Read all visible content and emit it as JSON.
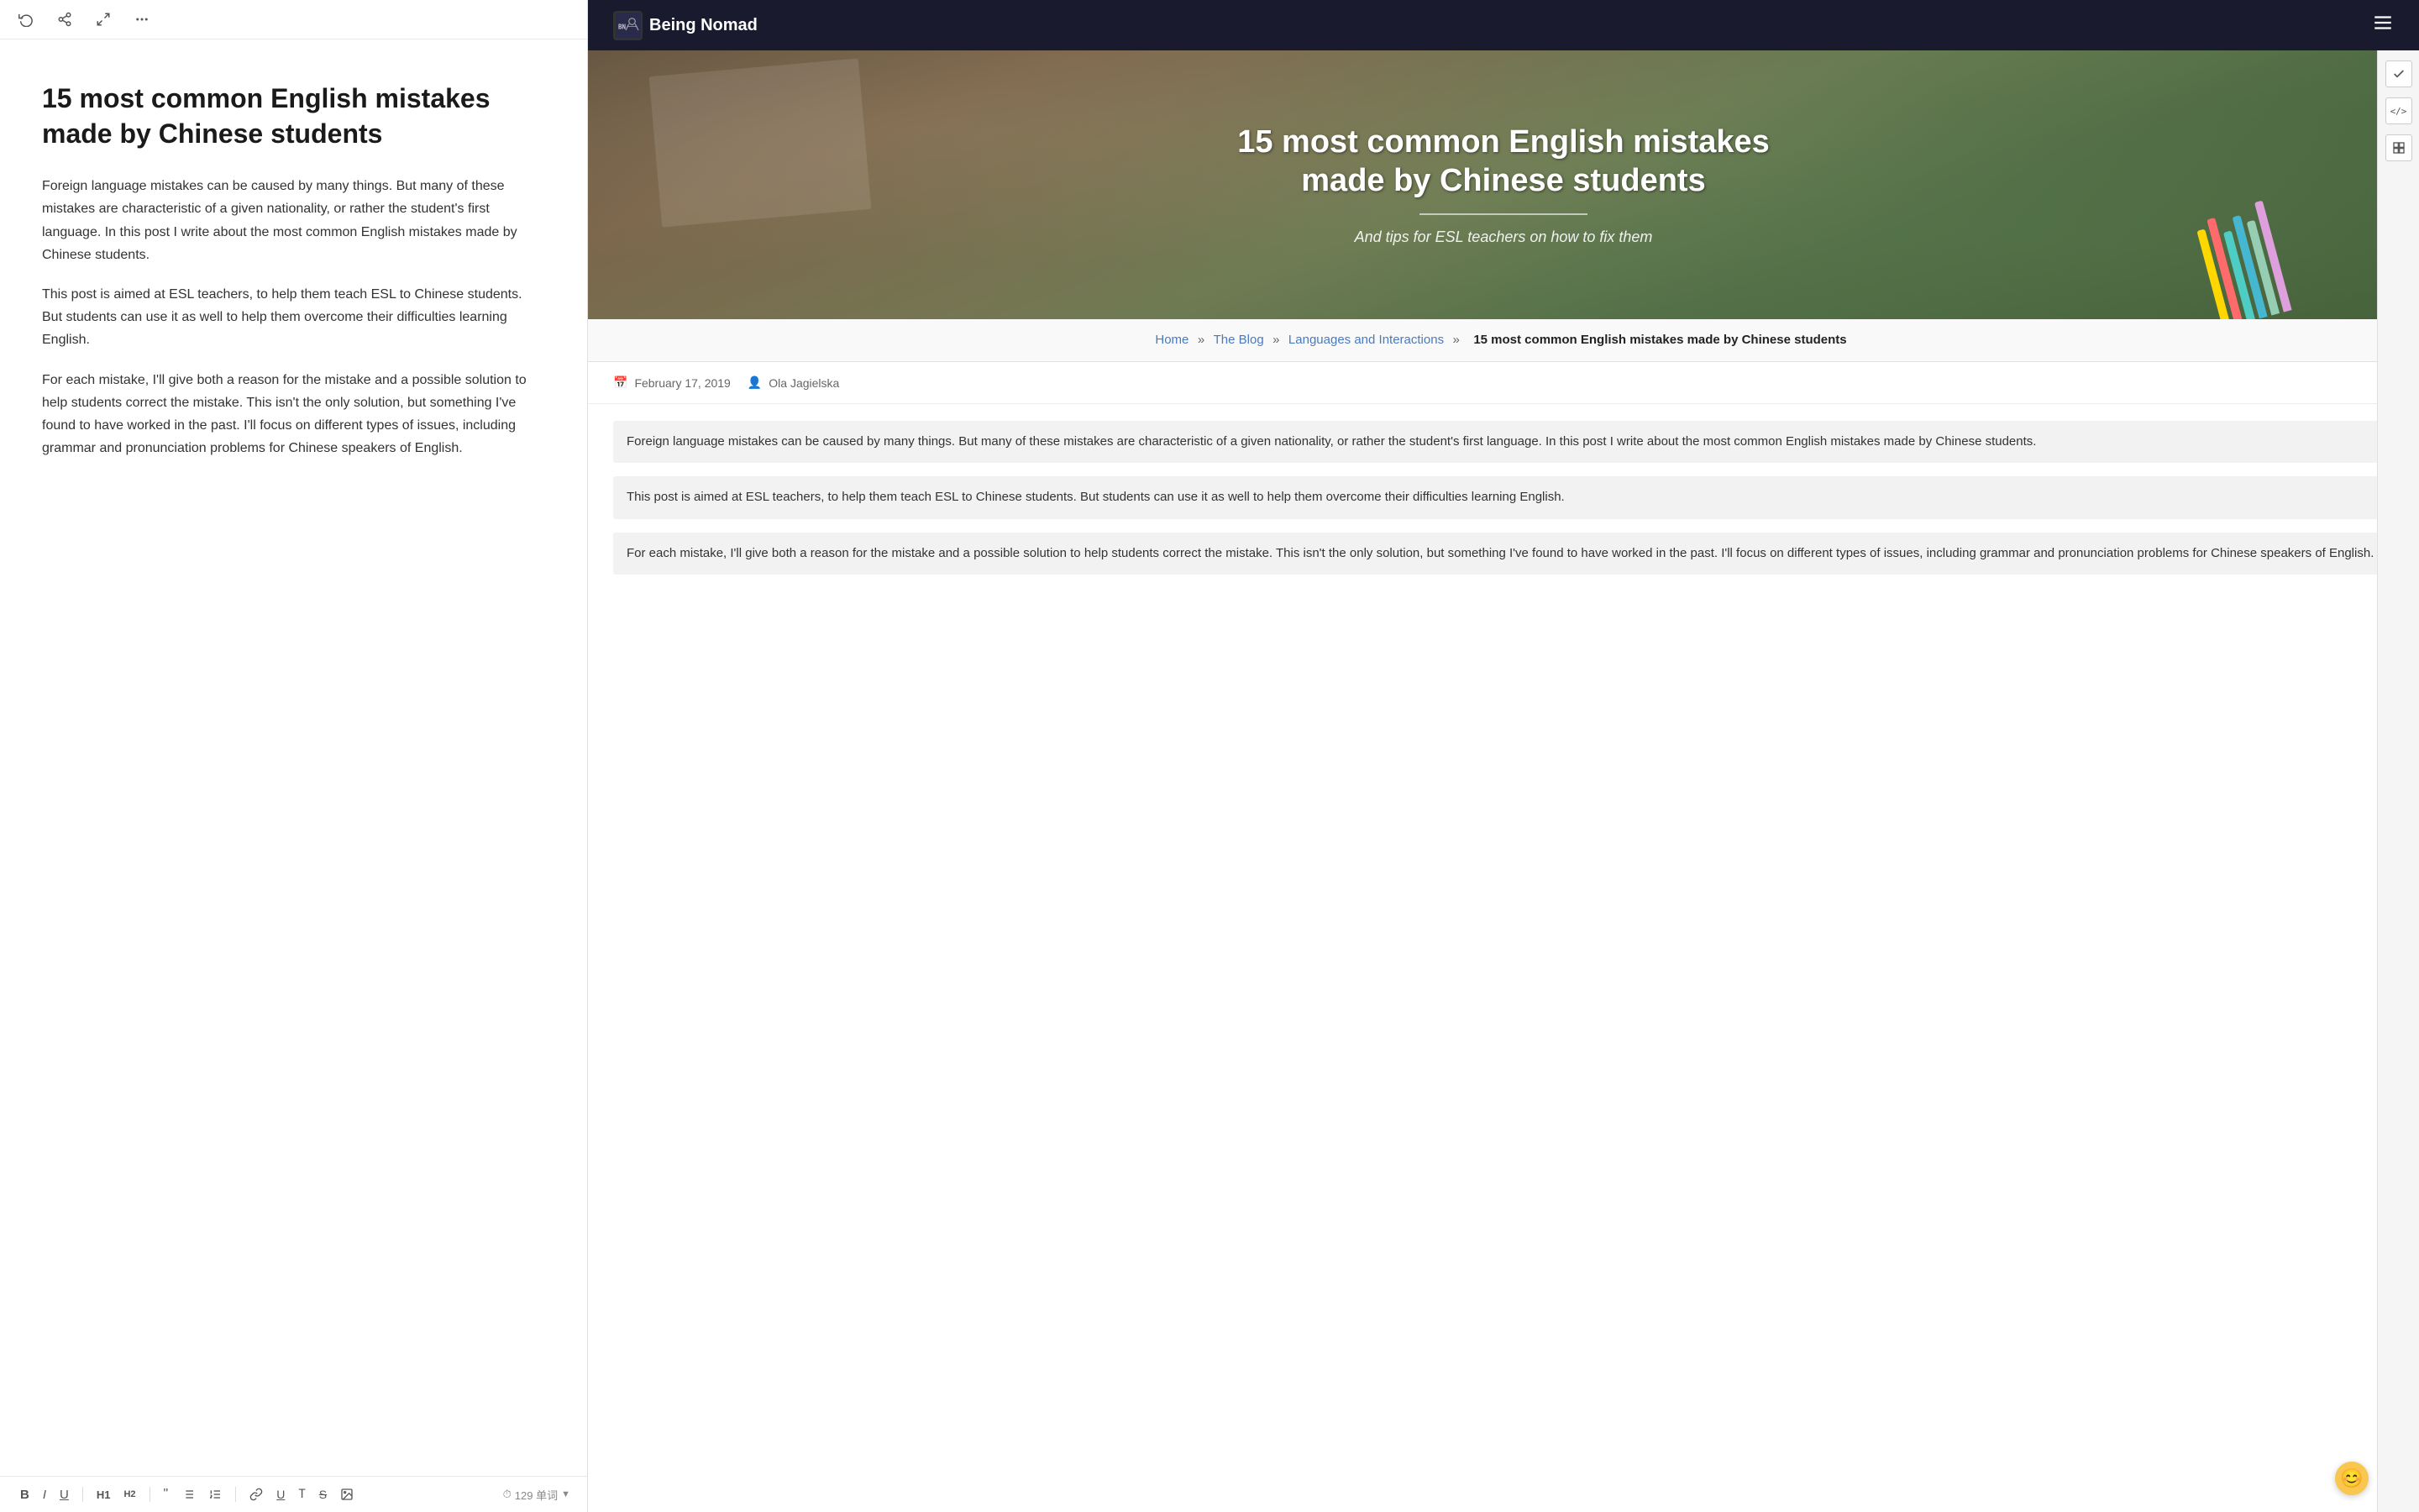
{
  "editor": {
    "toolbar": {
      "refresh_label": "↺",
      "share_label": "⤷",
      "expand_label": "⤢",
      "more_label": "···"
    },
    "title": "15 most common English mistakes made by Chinese students",
    "paragraphs": [
      "Foreign language mistakes can be caused by many things. But many of these mistakes are characteristic of a given nationality, or rather the student's first language. In this post I write about the most common English mistakes made by Chinese students.",
      "This post is aimed at ESL teachers, to help them teach ESL to Chinese students. But students can use it as well to help them overcome their difficulties learning English.",
      "For each mistake, I'll give both a reason for the mistake and a possible solution to help students correct the mistake. This isn't the only solution, but something I've found to have worked in the past. I'll focus on different types of issues, including grammar and pronunciation problems for Chinese speakers of English."
    ],
    "bottom_toolbar": {
      "bold": "B",
      "italic": "I",
      "underline": "U",
      "heading1": "H1",
      "heading2": "H2",
      "quote": "“”",
      "list_unordered": "≡",
      "list_ordered": "≡",
      "link": "🔗",
      "underline2": "U̲",
      "typewriter": "T",
      "strike": "S̶",
      "image": "⊡",
      "word_count": "129 单词",
      "clock_icon": "⏱"
    }
  },
  "website": {
    "nav": {
      "logo_text": "Being Nomad",
      "logo_icon_text": "🏔"
    },
    "hero": {
      "title": "15 most common English mistakes made by Chinese students",
      "subtitle": "And tips for ESL teachers on how to fix them"
    },
    "breadcrumb": {
      "home": "Home",
      "blog": "The Blog",
      "category": "Languages and Interactions",
      "current": "15 most common English mistakes made by Chinese students",
      "separator": "»"
    },
    "post_meta": {
      "date": "February 17, 2019",
      "author": "Ola Jagielska",
      "calendar_icon": "📅",
      "author_icon": "👤"
    },
    "article_paragraphs": [
      "Foreign language mistakes can be caused by many things. But many of these mistakes are characteristic of a given nationality, or rather the student's first language. In this post I write about the most common English mistakes made by Chinese students.",
      "This post is aimed at ESL teachers, to help them teach ESL to Chinese students. But students can use it as well to help them overcome their difficulties learning English.",
      "For each mistake, I'll give both a reason for the mistake and a possible solution to help students correct the mistake. This isn't the only solution, but something I've found to have worked in the past. I'll focus on different types of issues, including grammar and pronunciation problems for Chinese speakers of English."
    ],
    "sidebar_icons": {
      "check": "✓",
      "code": "</>",
      "stack": "⊞"
    },
    "emoji_feedback": "😊",
    "pencil_colors": [
      "#FFD700",
      "#FF6B6B",
      "#4ECDC4",
      "#45B7D1",
      "#96CEB4",
      "#FFEAA7",
      "#DDA0DD",
      "#98D8C8"
    ]
  }
}
